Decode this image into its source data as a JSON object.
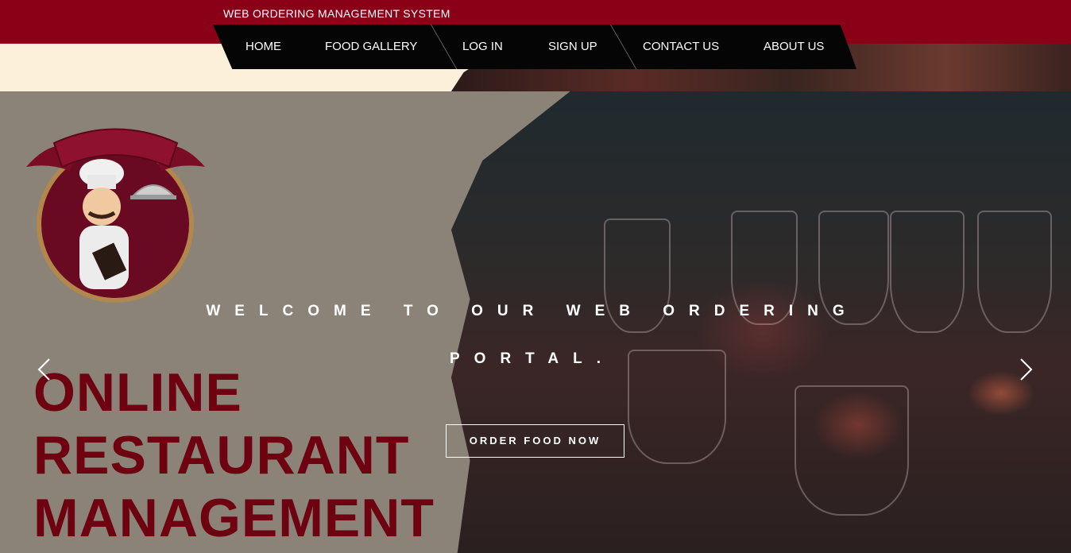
{
  "header": {
    "site_title": "WEB ORDERING MANAGEMENT SYSTEM"
  },
  "nav": {
    "items": [
      {
        "label": "HOME"
      },
      {
        "label": "FOOD GALLERY"
      },
      {
        "label": "LOG IN"
      },
      {
        "label": "SIGN UP"
      },
      {
        "label": "CONTACT US"
      },
      {
        "label": "ABOUT US"
      }
    ]
  },
  "hero": {
    "logo_title_lines": [
      "ONLINE",
      "RESTAURANT",
      "MANAGEMENT"
    ],
    "welcome_line1": "WELCOME TO OUR WEB ORDERING",
    "welcome_line2": "PORTAL.",
    "cta_label": "ORDER FOOD NOW",
    "prev_icon": "chevron-left-icon",
    "next_icon": "chevron-right-icon"
  },
  "colors": {
    "brand_red": "#8a0016",
    "nav_black": "#050505",
    "logo_text": "#6e0210",
    "hero_bg": "#8b8377"
  }
}
